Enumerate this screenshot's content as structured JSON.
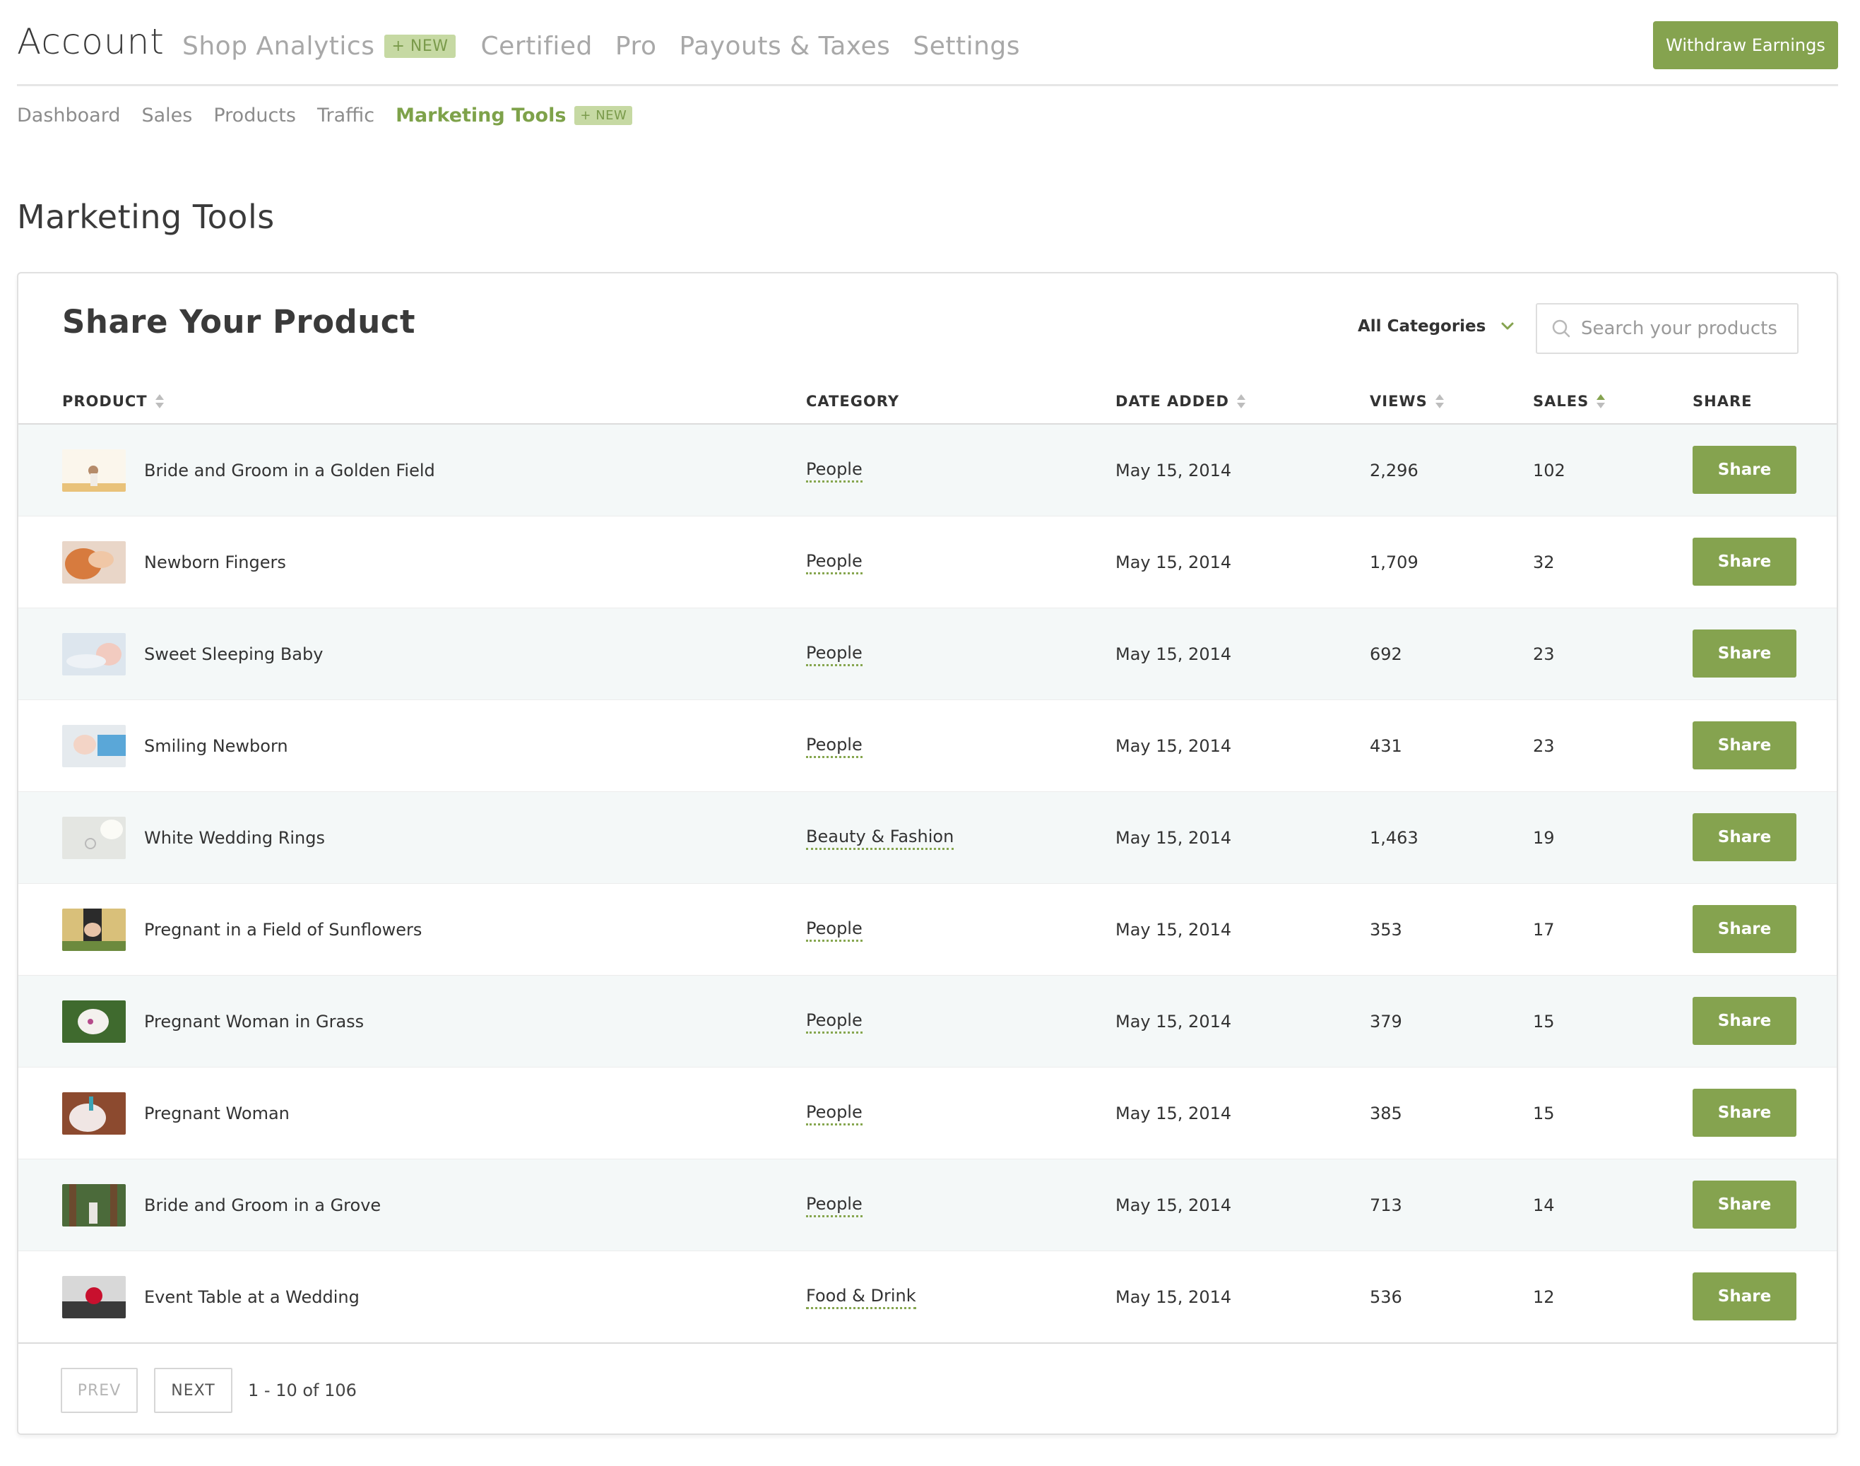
{
  "header": {
    "brand": "Account",
    "nav": [
      "Shop Analytics",
      "Certified",
      "Pro",
      "Payouts & Taxes",
      "Settings"
    ],
    "new_badge": "NEW",
    "withdraw_label": "Withdraw Earnings"
  },
  "subnav": {
    "items": [
      "Dashboard",
      "Sales",
      "Products",
      "Traffic"
    ],
    "active": "Marketing Tools",
    "new_badge": "NEW"
  },
  "page_title": "Marketing Tools",
  "card": {
    "title": "Share Your Product",
    "category_filter": "All Categories",
    "search_placeholder": "Search your products"
  },
  "table": {
    "columns": [
      "PRODUCT",
      "CATEGORY",
      "DATE ADDED",
      "VIEWS",
      "SALES",
      "SHARE"
    ],
    "share_label": "Share",
    "rows": [
      {
        "product": "Bride and Groom in a Golden Field",
        "category": "People",
        "date": "May 15, 2014",
        "views": "2,296",
        "sales": "102"
      },
      {
        "product": "Newborn Fingers",
        "category": "People",
        "date": "May 15, 2014",
        "views": "1,709",
        "sales": "32"
      },
      {
        "product": "Sweet Sleeping Baby",
        "category": "People",
        "date": "May 15, 2014",
        "views": "692",
        "sales": "23"
      },
      {
        "product": "Smiling Newborn",
        "category": "People",
        "date": "May 15, 2014",
        "views": "431",
        "sales": "23"
      },
      {
        "product": "White Wedding Rings",
        "category": "Beauty & Fashion",
        "date": "May 15, 2014",
        "views": "1,463",
        "sales": "19"
      },
      {
        "product": "Pregnant in a Field of Sunflowers",
        "category": "People",
        "date": "May 15, 2014",
        "views": "353",
        "sales": "17"
      },
      {
        "product": "Pregnant Woman in Grass",
        "category": "People",
        "date": "May 15, 2014",
        "views": "379",
        "sales": "15"
      },
      {
        "product": "Pregnant Woman",
        "category": "People",
        "date": "May 15, 2014",
        "views": "385",
        "sales": "15"
      },
      {
        "product": "Bride and Groom in a Grove",
        "category": "People",
        "date": "May 15, 2014",
        "views": "713",
        "sales": "14"
      },
      {
        "product": "Event Table at a Wedding",
        "category": "Food & Drink",
        "date": "May 15, 2014",
        "views": "536",
        "sales": "12"
      }
    ]
  },
  "pagination": {
    "prev": "PREV",
    "next": "NEXT",
    "info": "1 - 10 of 106"
  },
  "colors": {
    "accent": "#85a34f",
    "badge_bg": "#c6d9a3",
    "row_alt": "#f4f8f8"
  }
}
